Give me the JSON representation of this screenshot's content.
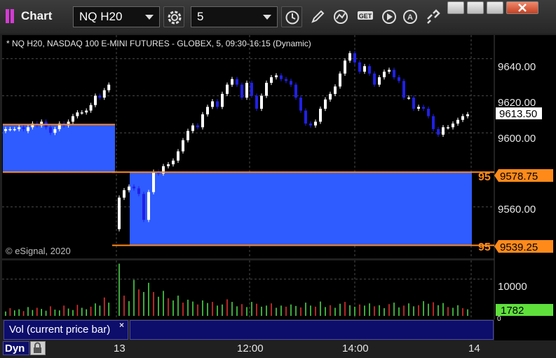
{
  "window": {
    "title": "Chart",
    "symbol": "NQ H20",
    "interval": "5"
  },
  "toolbar": {
    "icons": [
      "settings-gear-icon",
      "clock-icon",
      "pencil-draw-icon",
      "study-curve-icon",
      "get-data-icon",
      "play-icon",
      "alert-icon",
      "link-icon"
    ],
    "get_label": "GET",
    "alert_label": "A"
  },
  "window_controls": [
    "restore-icon",
    "minimize-icon",
    "maximize-icon",
    "close-icon"
  ],
  "chart": {
    "header": "* NQ H20, NASDAQ 100 E-MINI FUTURES - GLOBEX, 5, 09:30-16:15 (Dynamic)",
    "copyright": "© eSignal, 2020",
    "price_ticks": [
      "9640.00",
      "9620.00",
      "9600.00",
      "9560.00"
    ],
    "last_price": "9613.50",
    "upper_line_value": "9578.75",
    "lower_line_value": "9539.25",
    "line_tag": "95",
    "volume_tick": "10000",
    "volume_last": "1782",
    "volume_zero": "0",
    "time_labels": [
      "13",
      "12:00",
      "14:00",
      "14"
    ],
    "colors": {
      "up": "#ffffff",
      "down": "#2020e6",
      "fill": "#2e5cff",
      "line": "#ff8a1a",
      "vol_up": "#4cd44c",
      "vol_down": "#e03030",
      "vol_badge": "#5fe03b"
    }
  },
  "volume_panel": {
    "label": "Vol (current price bar)",
    "close": "×"
  },
  "footer": {
    "dyn": "Dyn"
  },
  "chart_data": {
    "type": "candlestick",
    "price_range": [
      9533,
      9652
    ],
    "volume_range": [
      0,
      14500
    ],
    "day1": {
      "open": [
        9601,
        9602,
        9602,
        9602,
        9603,
        9601,
        9603,
        9605,
        9604,
        9606,
        9603,
        9600,
        9602,
        9605,
        9604,
        9606,
        9609,
        9611,
        9611,
        9612,
        9615,
        9620,
        9619,
        9623
      ],
      "close": [
        9602,
        9602,
        9602,
        9603,
        9602,
        9603,
        9605,
        9604,
        9606,
        9603,
        9600,
        9602,
        9605,
        9604,
        9606,
        9609,
        9611,
        9611,
        9612,
        9615,
        9620,
        9619,
        9623,
        9626
      ]
    },
    "day2": {
      "open": [
        9548,
        9565,
        9569,
        9571,
        9570,
        9567,
        9553,
        9568,
        9579,
        9578,
        9582,
        9583,
        9585,
        9590,
        9596,
        9601,
        9604,
        9603,
        9610,
        9614,
        9617,
        9614,
        9621,
        9626,
        9629,
        9626,
        9619,
        9627,
        9620,
        9613,
        9620,
        9627,
        9630,
        9631,
        9629,
        9628,
        9626,
        9619,
        9612,
        9605,
        9604,
        9606,
        9613,
        9618,
        9621,
        9625,
        9632,
        9639,
        9643,
        9638,
        9633,
        9636,
        9632,
        9626,
        9630,
        9633,
        9634,
        9630,
        9628,
        9619,
        9619,
        9613,
        9614,
        9613,
        9609,
        9602,
        9599,
        9603,
        9603,
        9605,
        9607,
        9609
      ],
      "close": [
        9565,
        9569,
        9571,
        9570,
        9567,
        9553,
        9568,
        9579,
        9578,
        9582,
        9583,
        9585,
        9590,
        9596,
        9601,
        9604,
        9603,
        9610,
        9614,
        9617,
        9614,
        9621,
        9626,
        9629,
        9626,
        9619,
        9627,
        9620,
        9613,
        9620,
        9627,
        9630,
        9631,
        9629,
        9628,
        9626,
        9619,
        9612,
        9605,
        9604,
        9606,
        9613,
        9618,
        9621,
        9625,
        9632,
        9639,
        9643,
        9638,
        9633,
        9636,
        9632,
        9626,
        9630,
        9633,
        9634,
        9630,
        9628,
        9619,
        9619,
        9613,
        9614,
        9613,
        9609,
        9602,
        9599,
        9603,
        9603,
        9605,
        9607,
        9609,
        9610
      ]
    },
    "volume_day1": [
      1200,
      2100,
      1500,
      1800,
      1300,
      2400,
      1600,
      2200,
      1900,
      1400,
      2600,
      1700,
      1500,
      2800,
      2000,
      1600,
      3000,
      2200,
      1800,
      2500,
      3400,
      2800,
      5000,
      3600
    ],
    "volume_day2": [
      14200,
      5500,
      4000,
      9800,
      7200,
      6500,
      9000,
      6500,
      5200,
      6800,
      4800,
      4200,
      5500,
      3600,
      4400,
      3900,
      3100,
      4200,
      3500,
      3800,
      2800,
      3100,
      4500,
      3800,
      2600,
      3200,
      2400,
      3800,
      3300,
      2500,
      2800,
      3400,
      2200,
      2800,
      2500,
      3100,
      2700,
      2300,
      3600,
      2800,
      2500,
      3900,
      2400,
      2900,
      2200,
      3300,
      3800,
      2900,
      2500,
      3100,
      2800,
      3400,
      2600,
      2900,
      2100,
      3200,
      3600,
      2300,
      2800,
      3400,
      2600,
      2900,
      4000,
      3300,
      3700,
      2900,
      3500,
      2400,
      2200,
      2900,
      2100,
      1782
    ]
  }
}
